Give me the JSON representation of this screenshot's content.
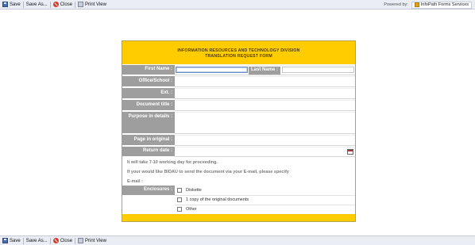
{
  "toolbar": {
    "save_label": "Save",
    "save_as_label": "Save As...",
    "close_label": "Close",
    "print_view_label": "Print View",
    "powered_by_label": "Powered by:",
    "infopath_label": "InfoPath Forms Services"
  },
  "form": {
    "header_line1": "INFORMATION RESOURCES AND TECHNOLOGY DIVISION",
    "header_line2": "TRANSLATION REQUEST FORM",
    "fields": {
      "first_name": "First Name :",
      "last_name": "Last Name :",
      "office_school": "Office/School :",
      "ext": "Ext. :",
      "document_title": "Document title :",
      "purpose": "Purpose in details :",
      "page_in_original": "Page in original :",
      "return_date": "Return date :"
    },
    "info": {
      "line1": "It will take 7-10 working day for proceeding.",
      "line2": "If your would like BIDAU to send the document via your E-mail, please specify",
      "line3": "E-mail :"
    },
    "enclosures_label": "Enclosures :",
    "options": [
      "Diskette",
      "1 copy of the original documents",
      "Other"
    ]
  },
  "icons": [
    "save-icon",
    "save-as-icon",
    "close-icon",
    "print-icon",
    "infopath-logo-icon",
    "calendar-icon",
    "checkbox-icon"
  ]
}
